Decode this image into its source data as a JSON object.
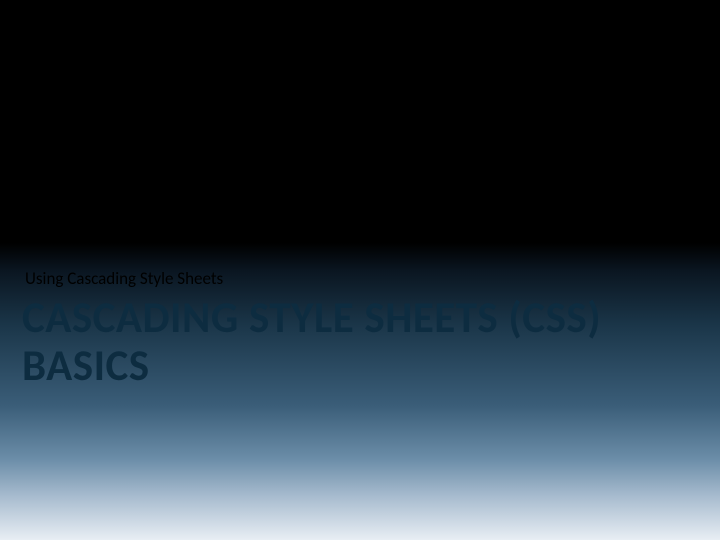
{
  "slide": {
    "subtitle": "Using Cascading Style Sheets",
    "title": "CASCADING STYLE SHEETS (CSS) BASICS"
  }
}
